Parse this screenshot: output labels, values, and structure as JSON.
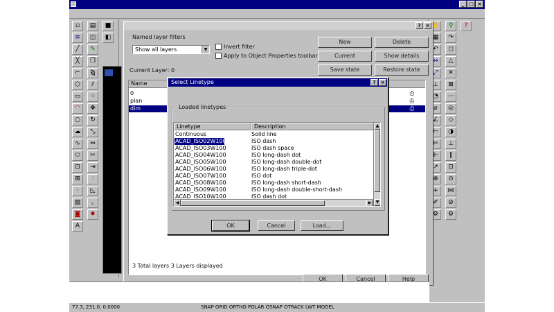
{
  "layer_dialog": {
    "named_filters_label": "Named layer filters",
    "filter_value": "Show all layers",
    "invert_filter": "Invert filter",
    "apply_toolbar": "Apply to Object Properties toolbar.",
    "new_button": "New",
    "delete_button": "Delete",
    "current_button": "Current",
    "show_details_button": "Show details",
    "current_layer": "Current Layer: 0",
    "layers": [
      "0",
      "plan",
      "dim"
    ],
    "summary": "3 Total layers  3 Layers displayed",
    "ok_button": "OK",
    "cancel_button": "Cancel",
    "help_button": "Help",
    "save_state_button": "Save state",
    "restore_state_button": "Restore state",
    "layer_name_header": "Name"
  },
  "linetype_dialog": {
    "title": "Select Linetype",
    "loaded_linetypes_label": "Loaded linetypes",
    "header_linetype": "Linetype",
    "header_description": "Description",
    "rows": [
      {
        "name": "Continuous",
        "desc": "Solid line"
      },
      {
        "name": "ACAD_ISO02W100",
        "desc": "ISO dash"
      },
      {
        "name": "ACAD_ISO03W100",
        "desc": "ISO dash space"
      },
      {
        "name": "ACAD_ISO04W100",
        "desc": "ISO long-dash dot"
      },
      {
        "name": "ACAD_ISO05W100",
        "desc": "ISO long-dash double-dot"
      },
      {
        "name": "ACAD_ISO06W100",
        "desc": "ISO long-dash triple-dot"
      },
      {
        "name": "ACAD_ISO07W100",
        "desc": "ISO dot"
      },
      {
        "name": "ACAD_ISO08W100",
        "desc": "ISO long-dash short-dash"
      },
      {
        "name": "ACAD_ISO09W100",
        "desc": "ISO long-dash double-short-dash"
      },
      {
        "name": "ACAD_ISO10W100",
        "desc": "ISO dash dot"
      }
    ],
    "ok_button": "OK",
    "cancel_button": "Cancel",
    "load_button": "Load..."
  },
  "status_bar": {
    "coords": "77.3, 231.0, 0.0000",
    "modes": "SNAP GRID ORTHO POLAR OSNAP OTRACK LWT MODEL"
  },
  "icons": {
    "left": [
      "line",
      "xline",
      "pline",
      "polygon",
      "rectangle",
      "arc",
      "circle",
      "revcloud",
      "spline",
      "ellipse",
      "insert",
      "block",
      "point",
      "hatch",
      "region",
      "mtext"
    ],
    "right": [
      "erase",
      "copy",
      "mirror",
      "offset",
      "array",
      "move",
      "rotate",
      "scale",
      "stretch",
      "trim",
      "extend",
      "break",
      "chamfer",
      "fillet",
      "explode"
    ]
  }
}
